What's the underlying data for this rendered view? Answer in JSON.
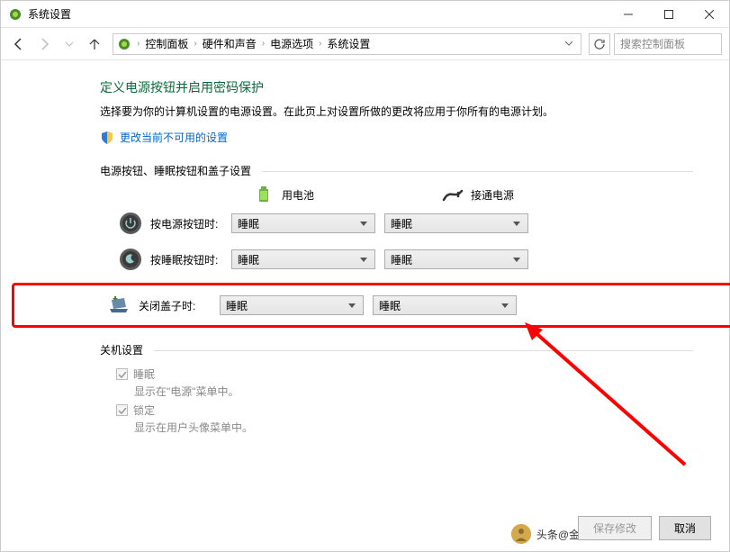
{
  "window": {
    "title": "系统设置"
  },
  "breadcrumb": {
    "items": [
      "控制面板",
      "硬件和声音",
      "电源选项",
      "系统设置"
    ]
  },
  "search": {
    "placeholder": "搜索控制面板"
  },
  "main": {
    "heading": "定义电源按钮并启用密码保护",
    "desc": "选择要为你的计算机设置的电源设置。在此页上对设置所做的更改将应用于你所有的电源计划。",
    "change_link": "更改当前不可用的设置",
    "section1_label": "电源按钮、睡眠按钮和盖子设置",
    "col_battery": "用电池",
    "col_plugged": "接通电源",
    "rows": [
      {
        "label": "按电源按钮时:",
        "battery": "睡眠",
        "plugged": "睡眠"
      },
      {
        "label": "按睡眠按钮时:",
        "battery": "睡眠",
        "plugged": "睡眠"
      },
      {
        "label": "关闭盖子时:",
        "battery": "睡眠",
        "plugged": "睡眠"
      }
    ],
    "section2_label": "关机设置",
    "checkboxes": [
      {
        "label": "睡眠",
        "desc": "显示在\"电源\"菜单中。"
      },
      {
        "label": "锁定",
        "desc": "显示在用户头像菜单中。"
      }
    ]
  },
  "footer": {
    "save": "保存修改",
    "cancel": "取消"
  },
  "watermark": "头条@金山毒霸"
}
